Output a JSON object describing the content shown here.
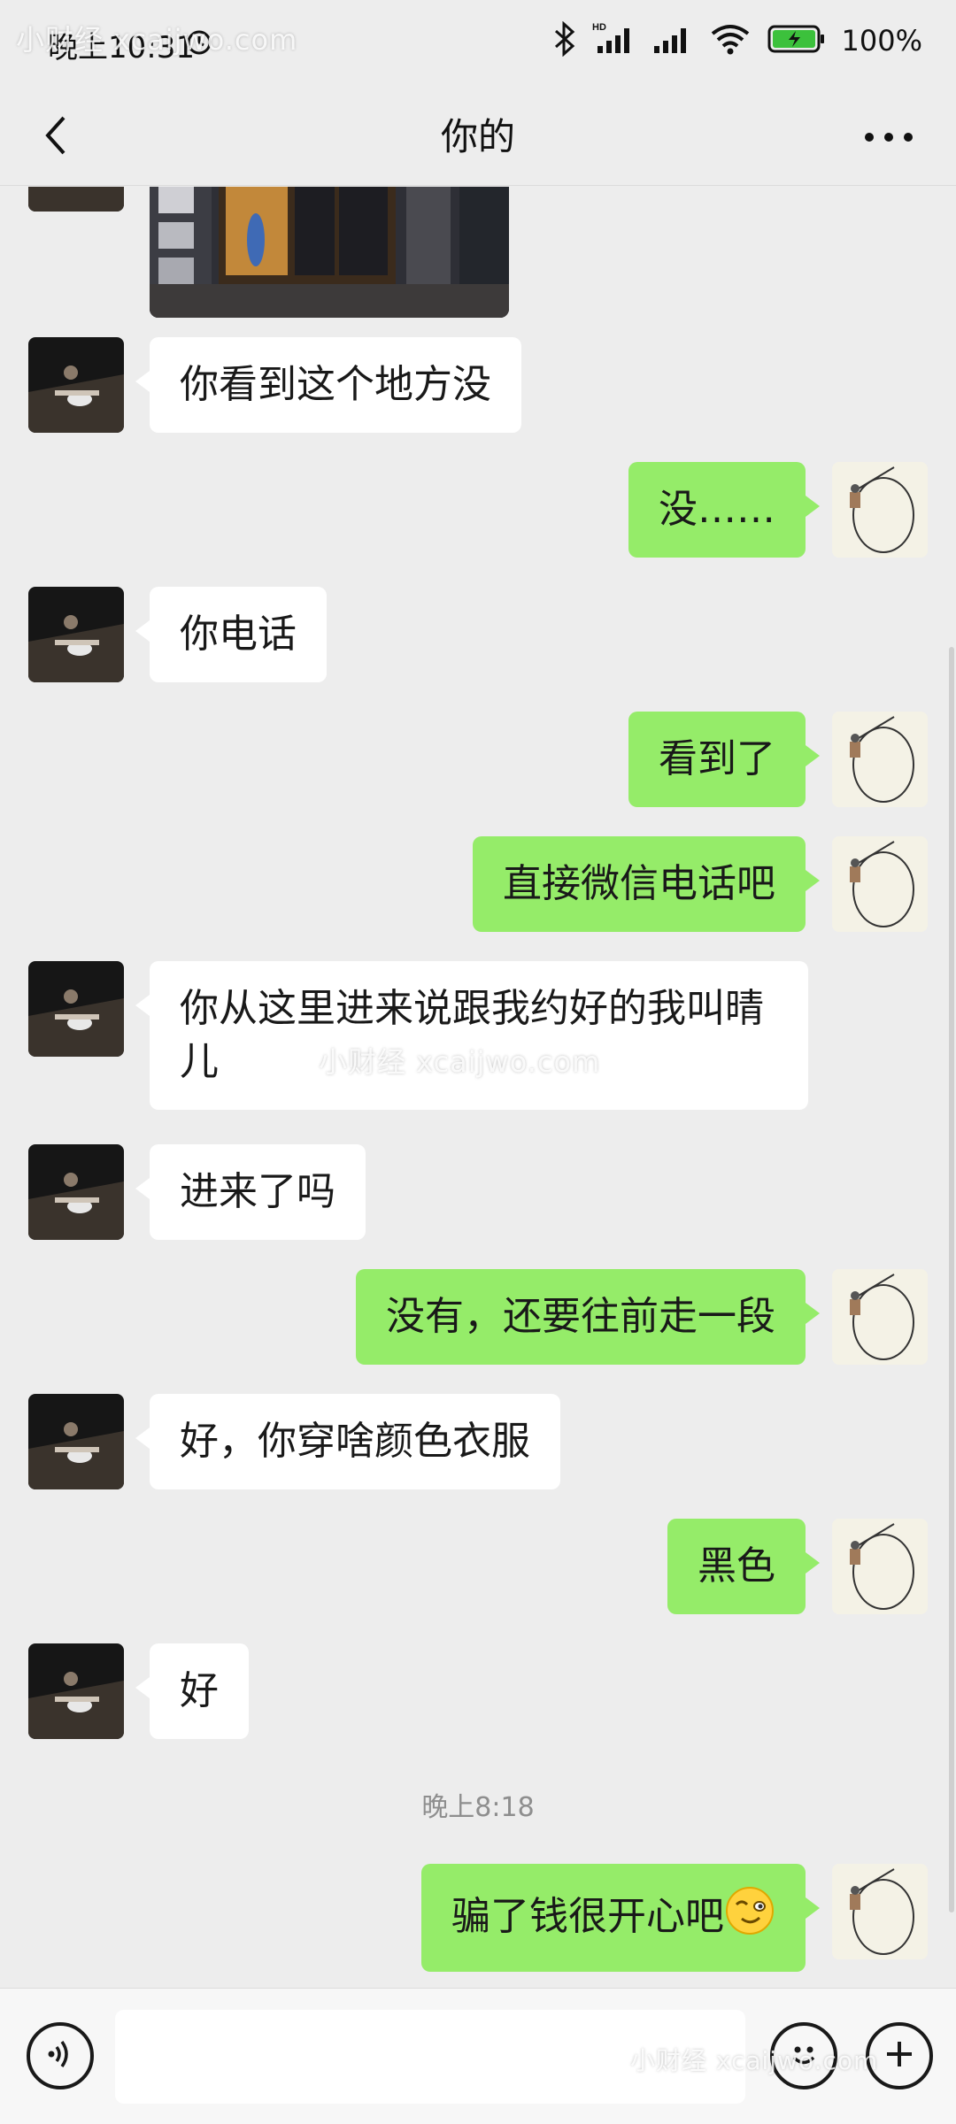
{
  "status_bar": {
    "time": "晚上10:31",
    "battery": "100%",
    "watermark": "小财经 xcaijwo.com"
  },
  "nav": {
    "title": "你的"
  },
  "messages": [
    {
      "side": "left",
      "text": "你看到这个地方没"
    },
    {
      "side": "right",
      "text": "没……"
    },
    {
      "side": "left",
      "text": "你电话"
    },
    {
      "side": "right",
      "text": "看到了"
    },
    {
      "side": "right",
      "text": "直接微信电话吧"
    },
    {
      "side": "left",
      "text": "你从这里进来说跟我约好的我叫晴儿"
    },
    {
      "side": "left",
      "text": "进来了吗"
    },
    {
      "side": "right",
      "text": "没有，还要往前走一段"
    },
    {
      "side": "left",
      "text": "好，你穿啥颜色衣服"
    },
    {
      "side": "right",
      "text": "黑色"
    },
    {
      "side": "left",
      "text": "好"
    },
    {
      "side": "right",
      "text": "骗了钱很开心吧"
    }
  ],
  "timestamp": "晚上8:18",
  "watermarks": {
    "middle": "小财经 xcaijwo.com",
    "bottom": "小财经 xcaijwo.com"
  },
  "colors": {
    "background": "#ededed",
    "bubble_self": "#95ec69",
    "bubble_other": "#ffffff"
  },
  "icons": [
    "back-arrow-icon",
    "more-dots-icon",
    "voice-icon",
    "emoji-icon",
    "plus-icon",
    "wink-emoji"
  ]
}
